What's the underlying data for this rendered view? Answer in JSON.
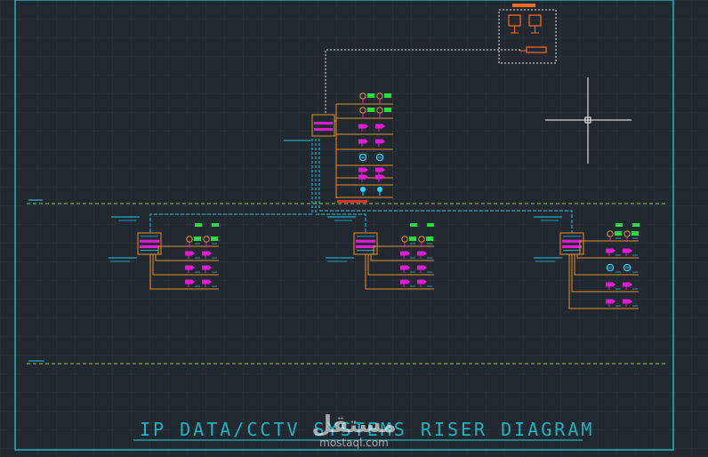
{
  "drawing": {
    "title": "IP DATA/CCTV SYSTEMS RISER DIAGRAM",
    "watermark": {
      "brand": "مستقل",
      "site": "mostaql.com"
    }
  },
  "colors": {
    "background": "#212830",
    "grid": "#2b3440",
    "frame": "#1fb4bf",
    "title": "#1fb4bf",
    "floor_line": "#9ad22a",
    "cable": "#e89028",
    "backbone": "#21c8e0",
    "device_magenta": "#e21ad4",
    "device_cyan": "#29d9ff",
    "device_green": "#22e23a",
    "head_end": "#ff6a1a",
    "dashed_link": "#ececec",
    "crosshair": "#ffffff",
    "watermark": "#ffffff"
  },
  "floors": [
    {
      "id": "floor-upper"
    },
    {
      "id": "floor-lower"
    }
  ],
  "panels": [
    {
      "id": "main-panel",
      "outlets": [
        "data-outlet",
        "data-outlet",
        "camera",
        "camera",
        "dome-camera",
        "camera",
        "camera",
        "wifi-ap"
      ]
    },
    {
      "id": "panel-left",
      "outlets": [
        "data-outlet",
        "camera",
        "camera",
        "camera"
      ]
    },
    {
      "id": "panel-center",
      "outlets": [
        "data-outlet",
        "camera",
        "camera",
        "camera"
      ]
    },
    {
      "id": "panel-right",
      "outlets": [
        "data-outlet",
        "camera",
        "dome-camera",
        "camera",
        "camera"
      ]
    }
  ],
  "head_end": {
    "devices": [
      "monitor",
      "monitor",
      "recorder"
    ]
  }
}
